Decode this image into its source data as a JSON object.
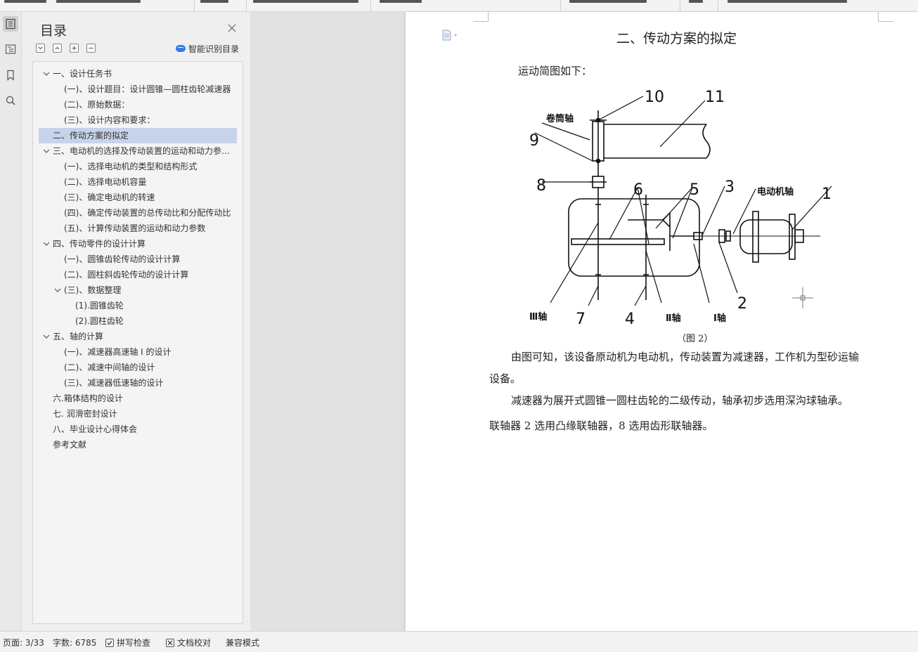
{
  "sidebar_rail": {
    "items": [
      {
        "icon": "outline-icon",
        "active": true
      },
      {
        "icon": "nav-tree-icon",
        "active": false
      },
      {
        "icon": "bookmark-icon",
        "active": false
      },
      {
        "icon": "search-icon",
        "active": false
      }
    ]
  },
  "toc": {
    "title": "目录",
    "ai_button": "智能识别目录",
    "items": [
      {
        "label": "一、设计任务书",
        "level": 1,
        "expanded": true,
        "selected": false
      },
      {
        "label": "(一)、设计题目：设计圆锥—圆柱齿轮减速器",
        "level": 2,
        "expanded": null,
        "selected": false
      },
      {
        "label": "(二)、原始数据：",
        "level": 2,
        "expanded": null,
        "selected": false
      },
      {
        "label": "(三)、设计内容和要求：",
        "level": 2,
        "expanded": null,
        "selected": false
      },
      {
        "label": "二、传动方案的拟定",
        "level": 1,
        "expanded": null,
        "selected": true
      },
      {
        "label": "三、电动机的选择及传动装置的运动和动力参数计算",
        "level": 1,
        "expanded": true,
        "selected": false
      },
      {
        "label": "(一)、选择电动机的类型和结构形式",
        "level": 2,
        "expanded": null,
        "selected": false
      },
      {
        "label": "(二)、选择电动机容量",
        "level": 2,
        "expanded": null,
        "selected": false
      },
      {
        "label": "(三)、确定电动机的转速",
        "level": 2,
        "expanded": null,
        "selected": false
      },
      {
        "label": "(四)、确定传动装置的总传动比和分配传动比",
        "level": 2,
        "expanded": null,
        "selected": false
      },
      {
        "label": "(五)、计算传动装置的运动和动力参数",
        "level": 2,
        "expanded": null,
        "selected": false
      },
      {
        "label": "四、传动零件的设计计算",
        "level": 1,
        "expanded": true,
        "selected": false
      },
      {
        "label": "(一)、圆锥齿轮传动的设计计算",
        "level": 2,
        "expanded": null,
        "selected": false
      },
      {
        "label": "(二)、圆柱斜齿轮传动的设计计算",
        "level": 2,
        "expanded": null,
        "selected": false
      },
      {
        "label": "(三)、数据整理",
        "level": 2,
        "expanded": true,
        "selected": false
      },
      {
        "label": "(1).圆锥齿轮",
        "level": 3,
        "expanded": null,
        "selected": false
      },
      {
        "label": "(2).圆柱齿轮",
        "level": 3,
        "expanded": null,
        "selected": false
      },
      {
        "label": "五、轴的计算",
        "level": 1,
        "expanded": true,
        "selected": false
      },
      {
        "label": "(一)、减速器高速轴 I 的设计",
        "level": 2,
        "expanded": null,
        "selected": false
      },
      {
        "label": "(二)、减速中间轴的设计",
        "level": 2,
        "expanded": null,
        "selected": false
      },
      {
        "label": "(三)、减速器低速轴的设计",
        "level": 2,
        "expanded": null,
        "selected": false
      },
      {
        "label": "六.箱体结构的设计",
        "level": 1,
        "expanded": null,
        "selected": false
      },
      {
        "label": "七. 润滑密封设计",
        "level": 1,
        "expanded": null,
        "selected": false
      },
      {
        "label": "八、毕业设计心得体会",
        "level": 1,
        "expanded": null,
        "selected": false
      },
      {
        "label": "参考文献",
        "level": 1,
        "expanded": null,
        "selected": false
      }
    ]
  },
  "document": {
    "heading": "二、传动方案的拟定",
    "intro": "运动简图如下：",
    "caption": "（图 2）",
    "p1_line1": "由图可知，该设备原动机为电动机，传动装置为减速器，工作机为型砂运输",
    "p1_line2": "设备。",
    "p2": "减速器为展开式圆锥一圆柱齿轮的二级传动，轴承初步选用深沟球轴承。",
    "p3": "联轴器 2 选用凸缘联轴器，8 选用齿形联轴器。",
    "figure_labels": {
      "drum_shaft": "卷筒轴",
      "motor_shaft": "电动机轴",
      "shaft3": "Ⅲ轴",
      "shaft2": "Ⅱ轴",
      "shaft1": "Ⅰ轴",
      "n1": "1",
      "n2": "2",
      "n3": "3",
      "n4": "4",
      "n5": "5",
      "n6": "6",
      "n7": "7",
      "n8": "8",
      "n9": "9",
      "n10": "10",
      "n11": "11"
    }
  },
  "status": {
    "page": "页面: 3/33",
    "words": "字数: 6785",
    "spell": "拼写检查",
    "proof": "文档校对",
    "compat": "兼容模式"
  }
}
